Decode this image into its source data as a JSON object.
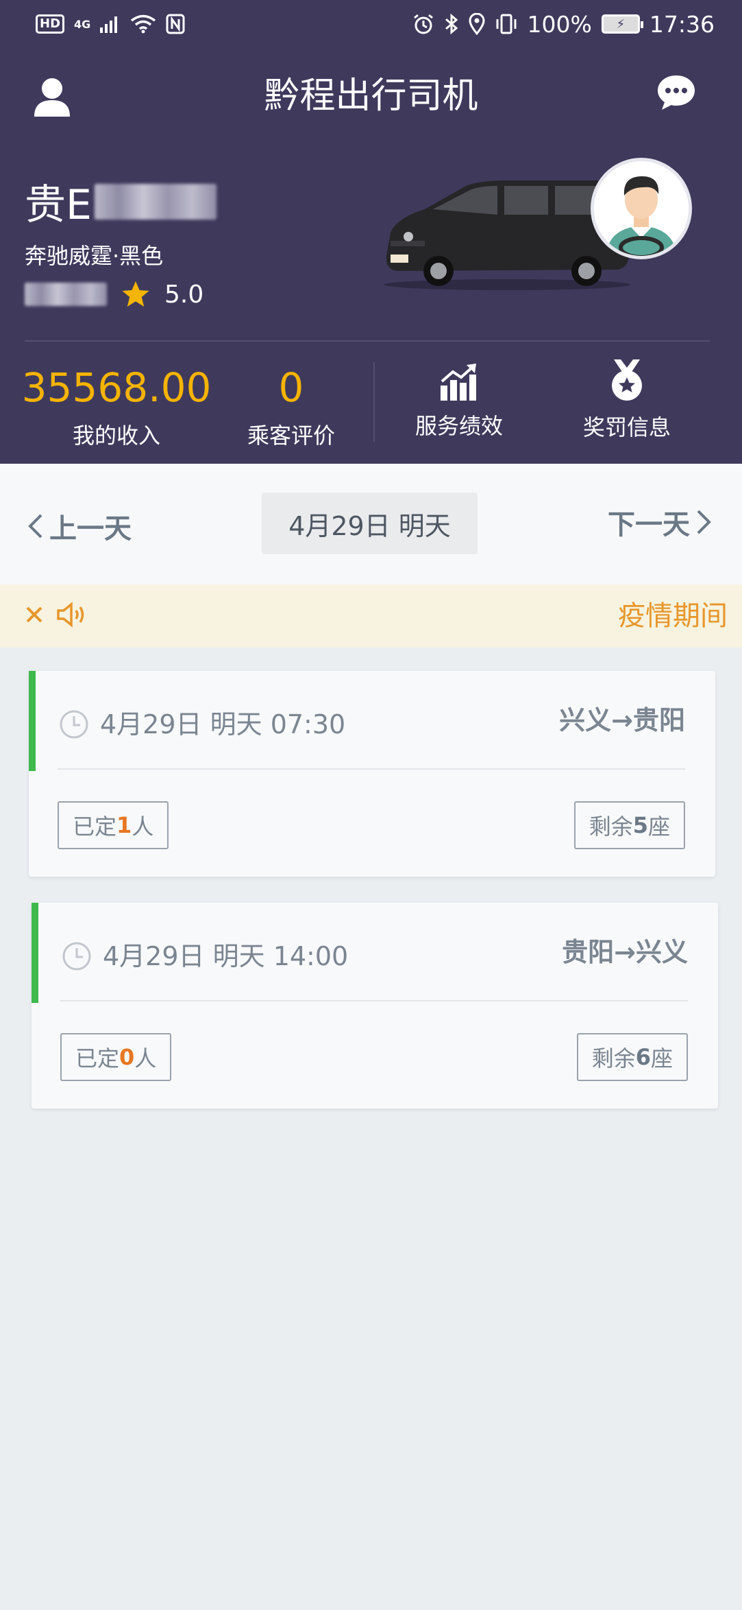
{
  "status_bar": {
    "left_badge": "HD",
    "network": "4G",
    "battery_percent": "100%",
    "time": "17:36"
  },
  "app": {
    "title": "黔程出行司机"
  },
  "driver": {
    "plate_prefix": "贵E",
    "car_model": "奔驰威霆·黑色",
    "rating": "5.0"
  },
  "stats": {
    "income_value": "35568.00",
    "income_label": "我的收入",
    "rating_count": "0",
    "rating_label": "乘客评价"
  },
  "actions": {
    "performance_label": "服务绩效",
    "rewards_label": "奖罚信息"
  },
  "date_nav": {
    "prev_label": "上一天",
    "current": "4月29日 明天",
    "next_label": "下一天"
  },
  "notice": {
    "text": "疫情期间"
  },
  "trips": [
    {
      "departure": "4月29日 明天 07:30",
      "route": "兴义→贵阳",
      "booked_prefix": "已定",
      "booked_count": "1",
      "booked_suffix": "人",
      "seats_prefix": "剩余",
      "seats_count": "5",
      "seats_suffix": "座"
    },
    {
      "departure": "4月29日 明天 14:00",
      "route": "贵阳→兴义",
      "booked_prefix": "已定",
      "booked_count": "0",
      "booked_suffix": "人",
      "seats_prefix": "剩余",
      "seats_count": "6",
      "seats_suffix": "座"
    }
  ],
  "colors": {
    "header_bg": "#3f3a5c",
    "accent_yellow": "#f5b400",
    "accent_green": "#3fb84c",
    "accent_orange": "#e87722",
    "notice_bg": "#f7f3e0"
  }
}
